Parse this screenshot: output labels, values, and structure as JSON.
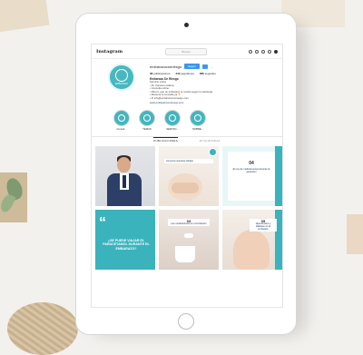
{
  "instagram": {
    "logo_text": "Instagram",
    "search_placeholder": "Buscar",
    "username": "embarazoconriesgo",
    "follow_label": "Seguir",
    "more_label": "...",
    "stats": {
      "posts_num": "98",
      "posts_label": "publicaciones",
      "followers_num": "443",
      "followers_label": "seguidores",
      "following_num": "889",
      "following_label": "seguidos"
    },
    "full_name": "Embarazo De Riesgo",
    "bio": [
      "Servicio online",
      "• Dr. Carrasco Adamo",
      "• Consulta online",
      "• Para ti, que un embarazo te motiva seguir tu patología",
      "• Reserva tu consulta ya 👇",
      "• ✉ info@embarazoconriesgo.com"
    ],
    "bio_link": "www.embarazoconriesgo.com",
    "avatar_text": "EMBARAZO",
    "highlights": [
      {
        "label": "Consul..."
      },
      {
        "label": "TEMAS"
      },
      {
        "label": "SERVICI..."
      },
      {
        "label": "SOBRE..."
      }
    ],
    "tabs": [
      {
        "label": "PUBLICACIONES"
      },
      {
        "label": "ETIQUETADAS"
      }
    ],
    "posts": {
      "p2_tag": "Aumenta nuestras células",
      "p3_number": "04",
      "p3_title": "El uso de medicamentos durante la gestación",
      "p4_question": "¿SE PUEDE VIAJAR EL PARACETAMOL DURANTE EL EMBARAZO?",
      "p5_number": "03",
      "p5_title": "Las medicaciones en el embarazo",
      "p6_number": "05",
      "p6_title": "Hipertensión y diabetes en el embarazo"
    }
  },
  "colors": {
    "teal": "#3bb3bc",
    "blue_button": "#3897f0",
    "navy_text": "#1e3a66"
  }
}
